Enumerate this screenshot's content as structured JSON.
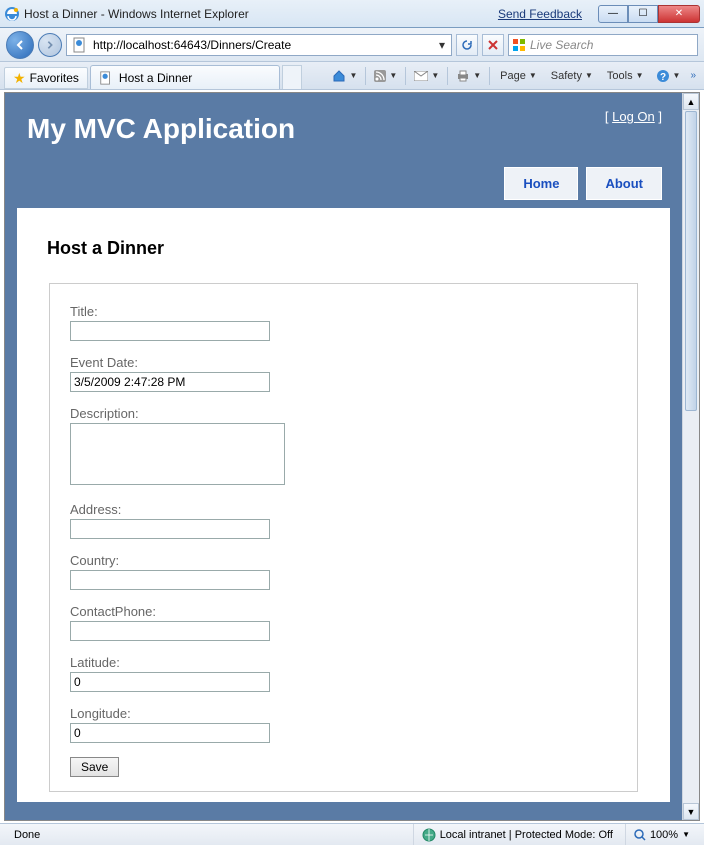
{
  "window": {
    "title": "Host a Dinner - Windows Internet Explorer",
    "feedback": "Send Feedback"
  },
  "nav": {
    "url": "http://localhost:64643/Dinners/Create",
    "search_placeholder": "Live Search"
  },
  "tabs": {
    "favorites": "Favorites",
    "tab1": "Host a Dinner"
  },
  "toolbar": {
    "page": "Page",
    "safety": "Safety",
    "tools": "Tools"
  },
  "app": {
    "title": "My MVC Application",
    "logon": "Log On",
    "menu_home": "Home",
    "menu_about": "About",
    "heading": "Host a Dinner"
  },
  "form": {
    "title_label": "Title:",
    "title_value": "",
    "eventdate_label": "Event Date:",
    "eventdate_value": "3/5/2009 2:47:28 PM",
    "description_label": "Description:",
    "description_value": "",
    "address_label": "Address:",
    "address_value": "",
    "country_label": "Country:",
    "country_value": "",
    "phone_label": "ContactPhone:",
    "phone_value": "",
    "latitude_label": "Latitude:",
    "latitude_value": "0",
    "longitude_label": "Longitude:",
    "longitude_value": "0",
    "save": "Save"
  },
  "status": {
    "done": "Done",
    "zone": "Local intranet | Protected Mode: Off",
    "zoom": "100%"
  }
}
